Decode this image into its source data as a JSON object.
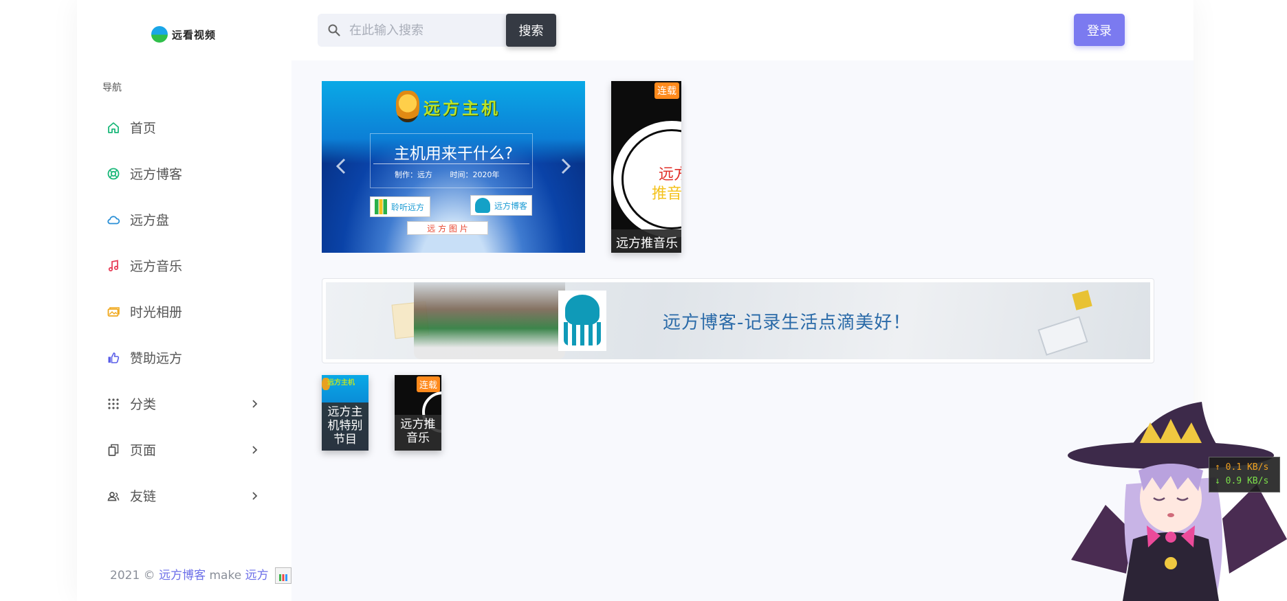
{
  "brand": {
    "name": "远看视频"
  },
  "nav": {
    "heading": "导航",
    "items": [
      {
        "label": "首页",
        "icon": "home-icon",
        "color": "#1bb87a"
      },
      {
        "label": "远方博客",
        "icon": "lifebuoy-icon",
        "color": "#1bb87a"
      },
      {
        "label": "远方盘",
        "icon": "cloud-icon",
        "color": "#2a8fd6"
      },
      {
        "label": "远方音乐",
        "icon": "music-note-icon",
        "color": "#e8405a"
      },
      {
        "label": "时光相册",
        "icon": "photo-album-icon",
        "color": "#f0a81c"
      },
      {
        "label": "赞助远方",
        "icon": "thumbs-up-icon",
        "color": "#5a5ee8"
      },
      {
        "label": "分类",
        "icon": "grid-dots-icon",
        "color": "#555555",
        "has_submenu": true
      },
      {
        "label": "页面",
        "icon": "copy-icon",
        "color": "#555555",
        "has_submenu": true
      },
      {
        "label": "友链",
        "icon": "users-icon",
        "color": "#555555",
        "has_submenu": true
      }
    ]
  },
  "header": {
    "search_placeholder": "在此输入搜索",
    "search_button": "搜索",
    "login_button": "登录"
  },
  "carousel": {
    "logo_text": "远方主机",
    "title": "主机用来干什么?",
    "author": "制作：远方",
    "time": "时间：2020年",
    "badges": [
      "聆听远方",
      "远方博客",
      "远 方 图 片"
    ]
  },
  "poster": {
    "badge": "连载",
    "overlay_line1": "远方",
    "overlay_line2": "推音",
    "caption": "远方推音乐"
  },
  "banner": {
    "text": "远方博客-记录生活点滴美好！"
  },
  "thumbs": [
    {
      "caption": "远方主机特别节目",
      "logo": "远方主机"
    },
    {
      "caption": "远方推音乐",
      "badge": "连载"
    }
  ],
  "footer": {
    "year": "2021 ©",
    "site_link": "远方博客",
    "make": "make",
    "author_link": "远方"
  },
  "netspeed": {
    "up": "0.1 KB/s",
    "down": "0.9 KB/s"
  },
  "colors": {
    "accent": "#7b7af0",
    "dark_button": "#353a43",
    "badge_orange": "#ff8a1c"
  }
}
